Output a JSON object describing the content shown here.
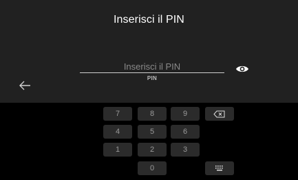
{
  "header": {
    "title": "Inserisci il PIN"
  },
  "pin": {
    "placeholder": "Inserisci il PIN",
    "value": "",
    "label": "PIN"
  },
  "icons": {
    "eye": "eye-icon",
    "back": "arrow-left-icon",
    "backspace": "backspace-icon",
    "keyboard": "keyboard-icon"
  },
  "keypad": {
    "k7": "7",
    "k8": "8",
    "k9": "9",
    "k4": "4",
    "k5": "5",
    "k6": "6",
    "k1": "1",
    "k2": "2",
    "k3": "3",
    "k0": "0"
  },
  "colors": {
    "panel": "#212121",
    "keyboard_bg": "#000000",
    "key_bg": "#2b2b2b",
    "key_text": "#9a9a9a",
    "title": "#ffffff"
  }
}
